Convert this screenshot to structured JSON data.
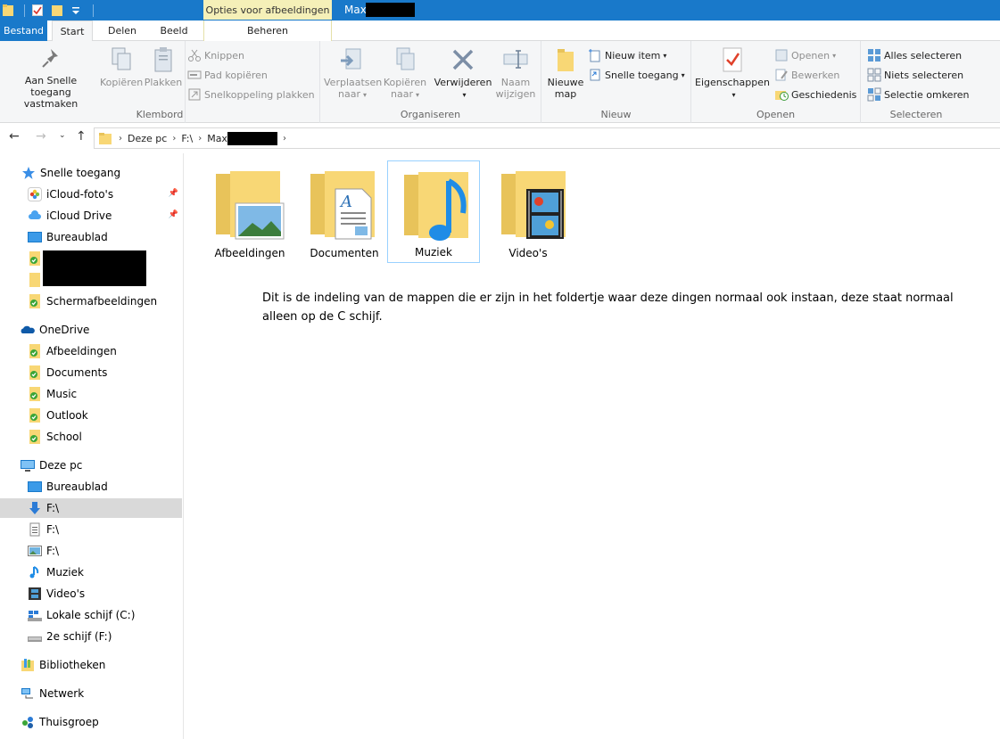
{
  "titlebar": {
    "context_tab": "Opties voor afbeeldingen",
    "window_title": "Max"
  },
  "tabs": {
    "file": "Bestand",
    "start": "Start",
    "share": "Delen",
    "view": "Beeld",
    "manage": "Beheren"
  },
  "ribbon": {
    "clipboard": {
      "label": "Klembord",
      "pin_line1": "Aan Snelle toegang",
      "pin_line2": "vastmaken",
      "copy": "Kopiëren",
      "paste": "Plakken",
      "cut": "Knippen",
      "copy_path": "Pad kopiëren",
      "paste_shortcut": "Snelkoppeling plakken"
    },
    "organize": {
      "label": "Organiseren",
      "move_line1": "Verplaatsen",
      "move_line2": "naar",
      "copyto_line1": "Kopiëren",
      "copyto_line2": "naar",
      "delete": "Verwijderen",
      "rename_line1": "Naam",
      "rename_line2": "wijzigen"
    },
    "new": {
      "label": "Nieuw",
      "folder_line1": "Nieuwe",
      "folder_line2": "map",
      "new_item": "Nieuw item",
      "easy_access": "Snelle toegang"
    },
    "open": {
      "label": "Openen",
      "properties": "Eigenschappen",
      "open": "Openen",
      "edit": "Bewerken",
      "history": "Geschiedenis"
    },
    "select": {
      "label": "Selecteren",
      "select_all": "Alles selecteren",
      "select_none": "Niets selecteren",
      "invert": "Selectie omkeren"
    }
  },
  "address": {
    "crumbs": [
      "Deze pc",
      "F:\\",
      "Max"
    ]
  },
  "nav": {
    "quick_access": "Snelle toegang",
    "icloud_photos": "iCloud-foto's",
    "icloud_drive": "iCloud Drive",
    "desktop": "Bureaublad",
    "screenshots": "Schermafbeeldingen",
    "onedrive": "OneDrive",
    "od_pictures": "Afbeeldingen",
    "od_documents": "Documents",
    "od_music": "Music",
    "od_outlook": "Outlook",
    "od_school": "School",
    "this_pc": "Deze pc",
    "pc_desktop": "Bureaublad",
    "pc_f1": "F:\\",
    "pc_f2": "F:\\",
    "pc_f3": "F:\\",
    "pc_music": "Muziek",
    "pc_videos": "Video's",
    "local_disk": "Lokale schijf (C:)",
    "second_disk": "2e schijf (F:)",
    "libraries": "Bibliotheken",
    "network": "Netwerk",
    "homegroup": "Thuisgroep"
  },
  "folders": [
    "Afbeeldingen",
    "Documenten",
    "Muziek",
    "Video's"
  ],
  "note": "Dit is de indeling van de mappen die er zijn in het foldertje waar deze dingen normaal ook instaan, deze staat normaal alleen op de C schijf.",
  "colors": {
    "accent": "#1979ca",
    "folder": "#f8d775",
    "selection": "#d9d9d9"
  }
}
